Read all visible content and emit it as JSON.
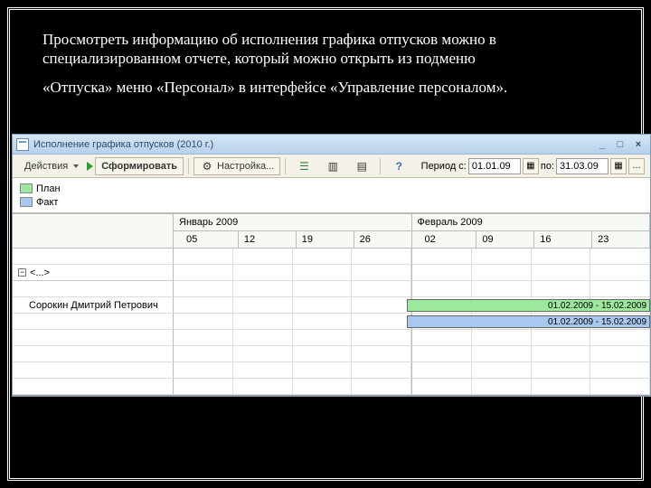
{
  "description": {
    "p1": "Просмотреть информацию об исполнения графика отпусков можно в специализированном отчете, который можно открыть из подменю",
    "p2": "«Отпуска» меню «Персонал» в интерфейсе «Управление персоналом»."
  },
  "window": {
    "title": "Исполнение графика отпусков (2010 г.)"
  },
  "toolbar": {
    "actions": "Действия",
    "generate": "Сформировать",
    "settings": "Настройка...",
    "period_label": "Период с:",
    "period_from": "01.01.09",
    "period_to_label": "по:",
    "period_to": "31.03.09"
  },
  "legend": {
    "plan": "План",
    "fact": "Факт"
  },
  "grid": {
    "month1": "Январь 2009",
    "month2": "Февраль 2009",
    "weeks1": [
      "05",
      "12",
      "19",
      "26"
    ],
    "weeks2": [
      "02",
      "09",
      "16",
      "23"
    ],
    "group_label": "<...>",
    "employee": "Сорокин Дмитрий Петрович",
    "bar_plan_text": "01.02.2009 - 15.02.2009",
    "bar_fact_text": "01.02.2009 - 15.02.2009"
  }
}
